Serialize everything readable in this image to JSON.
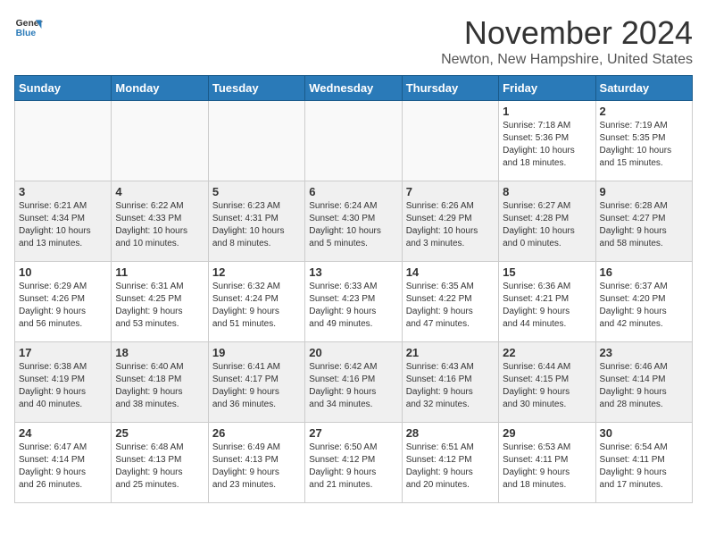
{
  "logo": {
    "line1": "General",
    "line2": "Blue"
  },
  "title": "November 2024",
  "location": "Newton, New Hampshire, United States",
  "weekdays": [
    "Sunday",
    "Monday",
    "Tuesday",
    "Wednesday",
    "Thursday",
    "Friday",
    "Saturday"
  ],
  "weeks": [
    [
      {
        "day": "",
        "info": ""
      },
      {
        "day": "",
        "info": ""
      },
      {
        "day": "",
        "info": ""
      },
      {
        "day": "",
        "info": ""
      },
      {
        "day": "",
        "info": ""
      },
      {
        "day": "1",
        "info": "Sunrise: 7:18 AM\nSunset: 5:36 PM\nDaylight: 10 hours\nand 18 minutes."
      },
      {
        "day": "2",
        "info": "Sunrise: 7:19 AM\nSunset: 5:35 PM\nDaylight: 10 hours\nand 15 minutes."
      }
    ],
    [
      {
        "day": "3",
        "info": "Sunrise: 6:21 AM\nSunset: 4:34 PM\nDaylight: 10 hours\nand 13 minutes."
      },
      {
        "day": "4",
        "info": "Sunrise: 6:22 AM\nSunset: 4:33 PM\nDaylight: 10 hours\nand 10 minutes."
      },
      {
        "day": "5",
        "info": "Sunrise: 6:23 AM\nSunset: 4:31 PM\nDaylight: 10 hours\nand 8 minutes."
      },
      {
        "day": "6",
        "info": "Sunrise: 6:24 AM\nSunset: 4:30 PM\nDaylight: 10 hours\nand 5 minutes."
      },
      {
        "day": "7",
        "info": "Sunrise: 6:26 AM\nSunset: 4:29 PM\nDaylight: 10 hours\nand 3 minutes."
      },
      {
        "day": "8",
        "info": "Sunrise: 6:27 AM\nSunset: 4:28 PM\nDaylight: 10 hours\nand 0 minutes."
      },
      {
        "day": "9",
        "info": "Sunrise: 6:28 AM\nSunset: 4:27 PM\nDaylight: 9 hours\nand 58 minutes."
      }
    ],
    [
      {
        "day": "10",
        "info": "Sunrise: 6:29 AM\nSunset: 4:26 PM\nDaylight: 9 hours\nand 56 minutes."
      },
      {
        "day": "11",
        "info": "Sunrise: 6:31 AM\nSunset: 4:25 PM\nDaylight: 9 hours\nand 53 minutes."
      },
      {
        "day": "12",
        "info": "Sunrise: 6:32 AM\nSunset: 4:24 PM\nDaylight: 9 hours\nand 51 minutes."
      },
      {
        "day": "13",
        "info": "Sunrise: 6:33 AM\nSunset: 4:23 PM\nDaylight: 9 hours\nand 49 minutes."
      },
      {
        "day": "14",
        "info": "Sunrise: 6:35 AM\nSunset: 4:22 PM\nDaylight: 9 hours\nand 47 minutes."
      },
      {
        "day": "15",
        "info": "Sunrise: 6:36 AM\nSunset: 4:21 PM\nDaylight: 9 hours\nand 44 minutes."
      },
      {
        "day": "16",
        "info": "Sunrise: 6:37 AM\nSunset: 4:20 PM\nDaylight: 9 hours\nand 42 minutes."
      }
    ],
    [
      {
        "day": "17",
        "info": "Sunrise: 6:38 AM\nSunset: 4:19 PM\nDaylight: 9 hours\nand 40 minutes."
      },
      {
        "day": "18",
        "info": "Sunrise: 6:40 AM\nSunset: 4:18 PM\nDaylight: 9 hours\nand 38 minutes."
      },
      {
        "day": "19",
        "info": "Sunrise: 6:41 AM\nSunset: 4:17 PM\nDaylight: 9 hours\nand 36 minutes."
      },
      {
        "day": "20",
        "info": "Sunrise: 6:42 AM\nSunset: 4:16 PM\nDaylight: 9 hours\nand 34 minutes."
      },
      {
        "day": "21",
        "info": "Sunrise: 6:43 AM\nSunset: 4:16 PM\nDaylight: 9 hours\nand 32 minutes."
      },
      {
        "day": "22",
        "info": "Sunrise: 6:44 AM\nSunset: 4:15 PM\nDaylight: 9 hours\nand 30 minutes."
      },
      {
        "day": "23",
        "info": "Sunrise: 6:46 AM\nSunset: 4:14 PM\nDaylight: 9 hours\nand 28 minutes."
      }
    ],
    [
      {
        "day": "24",
        "info": "Sunrise: 6:47 AM\nSunset: 4:14 PM\nDaylight: 9 hours\nand 26 minutes."
      },
      {
        "day": "25",
        "info": "Sunrise: 6:48 AM\nSunset: 4:13 PM\nDaylight: 9 hours\nand 25 minutes."
      },
      {
        "day": "26",
        "info": "Sunrise: 6:49 AM\nSunset: 4:13 PM\nDaylight: 9 hours\nand 23 minutes."
      },
      {
        "day": "27",
        "info": "Sunrise: 6:50 AM\nSunset: 4:12 PM\nDaylight: 9 hours\nand 21 minutes."
      },
      {
        "day": "28",
        "info": "Sunrise: 6:51 AM\nSunset: 4:12 PM\nDaylight: 9 hours\nand 20 minutes."
      },
      {
        "day": "29",
        "info": "Sunrise: 6:53 AM\nSunset: 4:11 PM\nDaylight: 9 hours\nand 18 minutes."
      },
      {
        "day": "30",
        "info": "Sunrise: 6:54 AM\nSunset: 4:11 PM\nDaylight: 9 hours\nand 17 minutes."
      }
    ]
  ]
}
